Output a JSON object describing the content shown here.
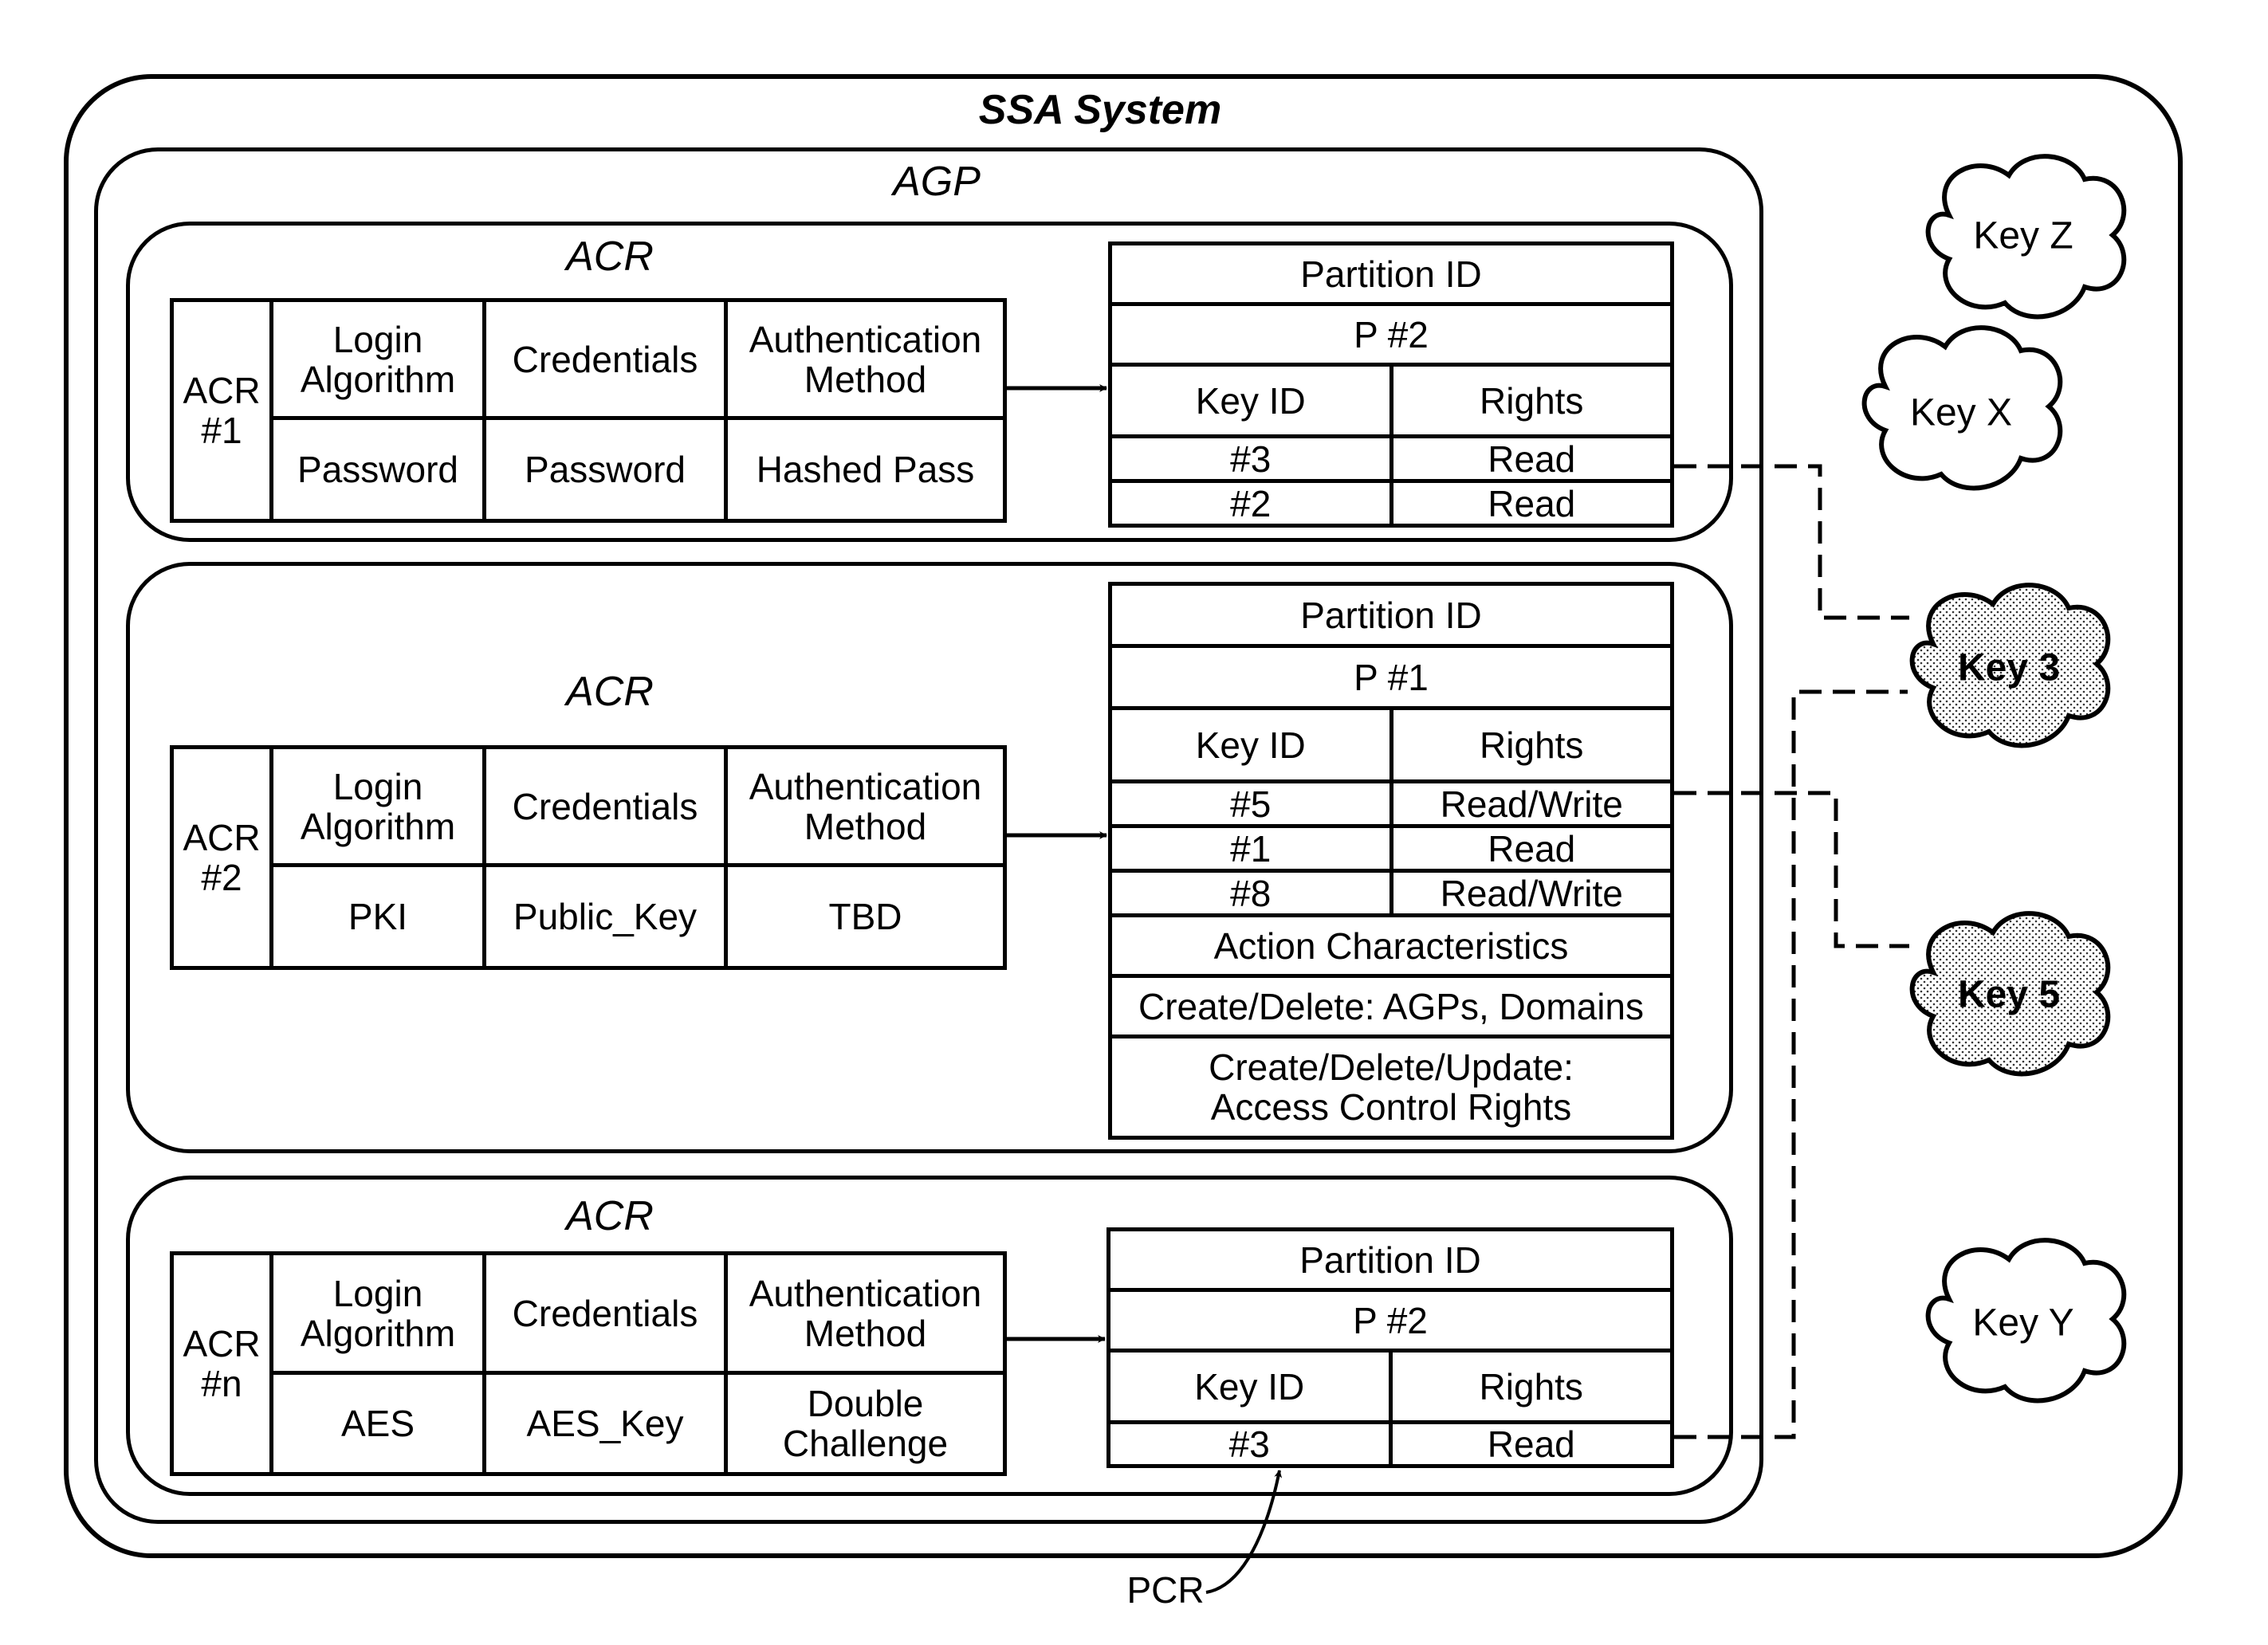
{
  "title": "SSA System",
  "agp_label": "AGP",
  "acrs": [
    {
      "label": "ACR",
      "id_label": "ACR\n#1",
      "headers": [
        "Login Algorithm",
        "Credentials",
        "Authentication Method"
      ],
      "values": [
        "Password",
        "Password",
        "Hashed Pass"
      ],
      "pcr": {
        "partition_header": "Partition ID",
        "partition": "P #2",
        "key_header": "Key ID",
        "rights_header": "Rights",
        "rows": [
          {
            "key": "#3",
            "rights": "Read"
          },
          {
            "key": "#2",
            "rights": "Read"
          }
        ]
      }
    },
    {
      "label": "ACR",
      "id_label": "ACR\n#2",
      "headers": [
        "Login Algorithm",
        "Credentials",
        "Authentication Method"
      ],
      "values": [
        "PKI",
        "Public_Key",
        "TBD"
      ],
      "pcr": {
        "partition_header": "Partition ID",
        "partition": "P #1",
        "key_header": "Key ID",
        "rights_header": "Rights",
        "rows": [
          {
            "key": "#5",
            "rights": "Read/Write"
          },
          {
            "key": "#1",
            "rights": "Read"
          },
          {
            "key": "#8",
            "rights": "Read/Write"
          }
        ],
        "action_header": "Action Characteristics",
        "actions": [
          "Create/Delete: AGPs, Domains",
          "Create/Delete/Update:\nAccess Control Rights"
        ]
      }
    },
    {
      "label": "ACR",
      "id_label": "ACR\n#n",
      "headers": [
        "Login Algorithm",
        "Credentials",
        "Authentication Method"
      ],
      "values": [
        "AES",
        "AES_Key",
        "Double Challenge"
      ],
      "pcr": {
        "partition_header": "Partition ID",
        "partition": "P #2",
        "key_header": "Key ID",
        "rights_header": "Rights",
        "rows": [
          {
            "key": "#3",
            "rights": "Read"
          }
        ]
      }
    }
  ],
  "keys": [
    {
      "label": "Key Z",
      "shaded": false
    },
    {
      "label": "Key X",
      "shaded": false
    },
    {
      "label": "Key 3",
      "shaded": true
    },
    {
      "label": "Key 5",
      "shaded": true
    },
    {
      "label": "Key Y",
      "shaded": false
    }
  ],
  "pcr_callout": "PCR"
}
